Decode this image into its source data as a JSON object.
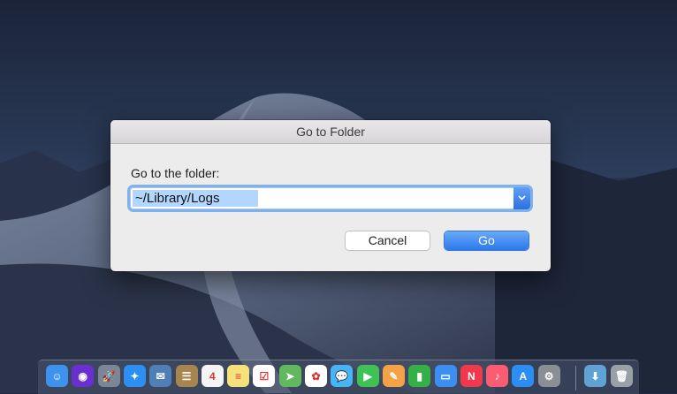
{
  "dialog": {
    "title": "Go to Folder",
    "prompt": "Go to the folder:",
    "path_value": "~/Library/Logs",
    "cancel_label": "Cancel",
    "go_label": "Go"
  },
  "dock": {
    "items": [
      {
        "icon": "finder-icon",
        "color": "#3d92f0",
        "glyph": "☺"
      },
      {
        "icon": "siri-icon",
        "color": "#6a2fd0",
        "glyph": "◉"
      },
      {
        "icon": "launchpad-icon",
        "color": "#7b8796",
        "glyph": "🚀"
      },
      {
        "icon": "safari-icon",
        "color": "#2d8ff2",
        "glyph": "✦"
      },
      {
        "icon": "mail-icon",
        "color": "#4e7fb6",
        "glyph": "✉"
      },
      {
        "icon": "contacts-icon",
        "color": "#a8844f",
        "glyph": "☰"
      },
      {
        "icon": "calendar-icon",
        "color": "#f4f4f4",
        "glyph": "4"
      },
      {
        "icon": "notes-icon",
        "color": "#f5e27b",
        "glyph": "≡"
      },
      {
        "icon": "reminders-icon",
        "color": "#ffffff",
        "glyph": "☑"
      },
      {
        "icon": "maps-icon",
        "color": "#62b85f",
        "glyph": "➤"
      },
      {
        "icon": "photos-icon",
        "color": "#ffffff",
        "glyph": "✿"
      },
      {
        "icon": "messages-icon",
        "color": "#45b5f8",
        "glyph": "💬"
      },
      {
        "icon": "facetime-icon",
        "color": "#3fc156",
        "glyph": "▶"
      },
      {
        "icon": "pages-icon",
        "color": "#f4a245",
        "glyph": "✎"
      },
      {
        "icon": "numbers-icon",
        "color": "#35b046",
        "glyph": "▮"
      },
      {
        "icon": "keynote-icon",
        "color": "#3d8ef2",
        "glyph": "▭"
      },
      {
        "icon": "news-icon",
        "color": "#f2384c",
        "glyph": "N"
      },
      {
        "icon": "music-icon",
        "color": "#fb5c74",
        "glyph": "♪"
      },
      {
        "icon": "app-store-icon",
        "color": "#2c8ef4",
        "glyph": "A"
      },
      {
        "icon": "system-preferences-icon",
        "color": "#8a8f96",
        "glyph": "⚙"
      },
      {
        "icon": "downloads-folder-icon",
        "color": "#5ea2d6",
        "glyph": "⬇"
      },
      {
        "icon": "trash-icon",
        "color": "#9aa0a8",
        "glyph": "🗑"
      }
    ]
  }
}
